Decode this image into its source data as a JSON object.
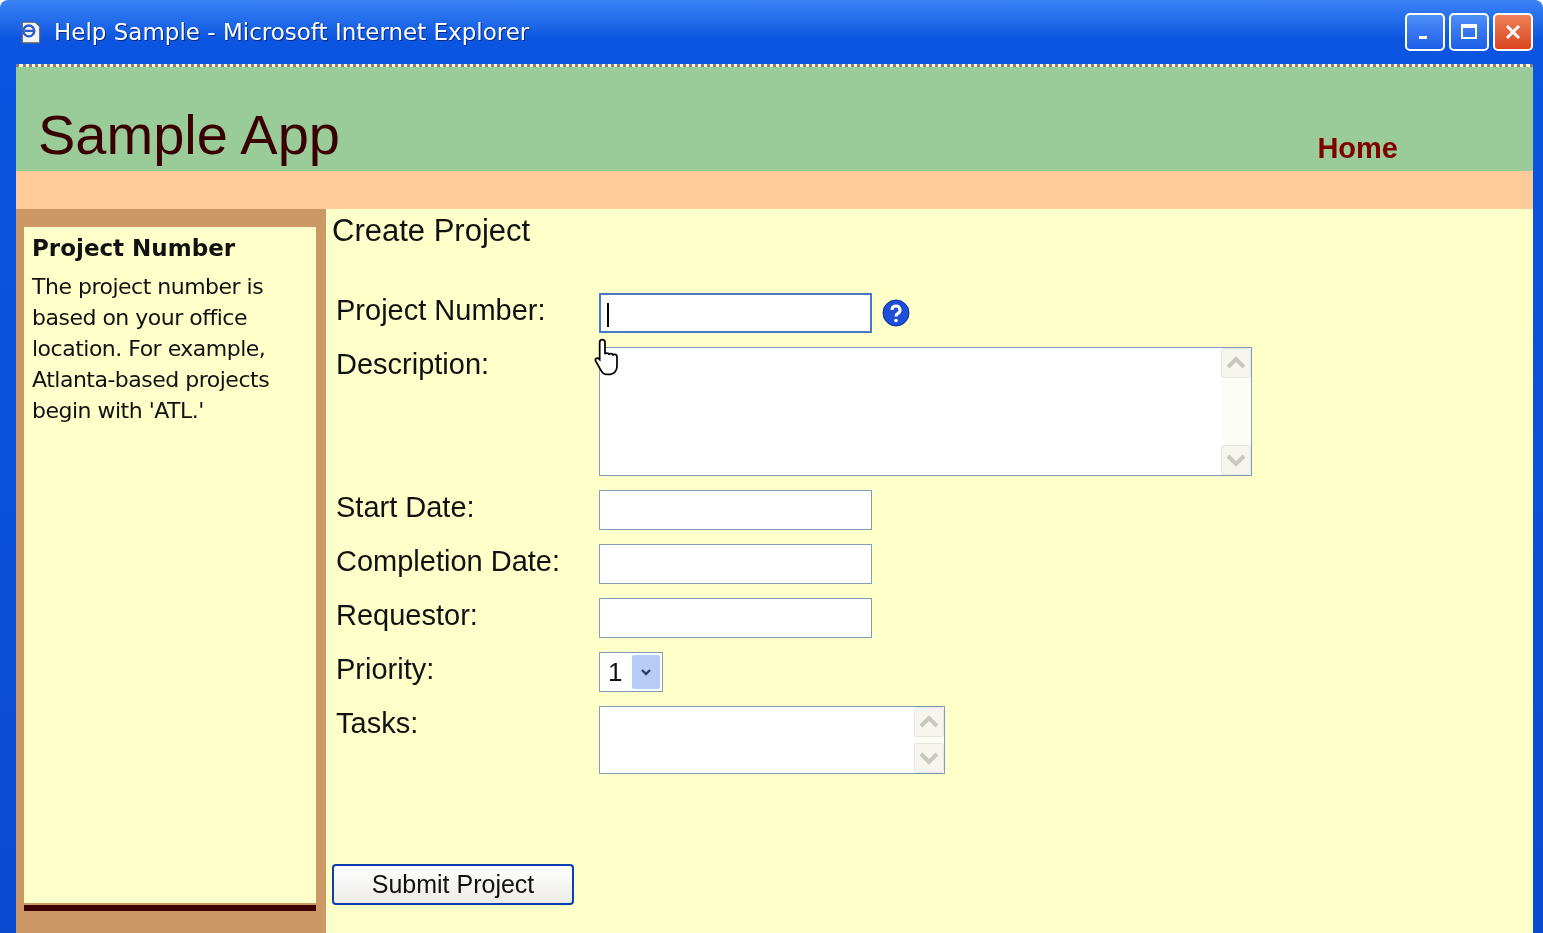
{
  "window": {
    "title": "Help Sample - Microsoft Internet Explorer"
  },
  "header": {
    "title": "Sample App",
    "nav_link": "Home"
  },
  "sidebar": {
    "help_title": "Project Number",
    "help_text": "The project number is based on your office location. For example, Atlanta-based projects begin with  'ATL.'"
  },
  "main": {
    "heading": "Create Project",
    "fields": [
      {
        "label": "Project Number:",
        "kind": "text",
        "focused": true,
        "has_help": true
      },
      {
        "label": "Description:",
        "kind": "memo",
        "focused": false,
        "has_help": false
      },
      {
        "label": "Start Date:",
        "kind": "text",
        "focused": false,
        "has_help": false
      },
      {
        "label": "Completion Date:",
        "kind": "text",
        "focused": false,
        "has_help": false
      },
      {
        "label": "Requestor:",
        "kind": "text",
        "focused": false,
        "has_help": false
      },
      {
        "label": "Priority:",
        "kind": "select",
        "value": "1",
        "focused": false,
        "has_help": false
      },
      {
        "label": "Tasks:",
        "kind": "textarea",
        "focused": false,
        "has_help": false
      }
    ],
    "submit_button": "Submit Project"
  }
}
